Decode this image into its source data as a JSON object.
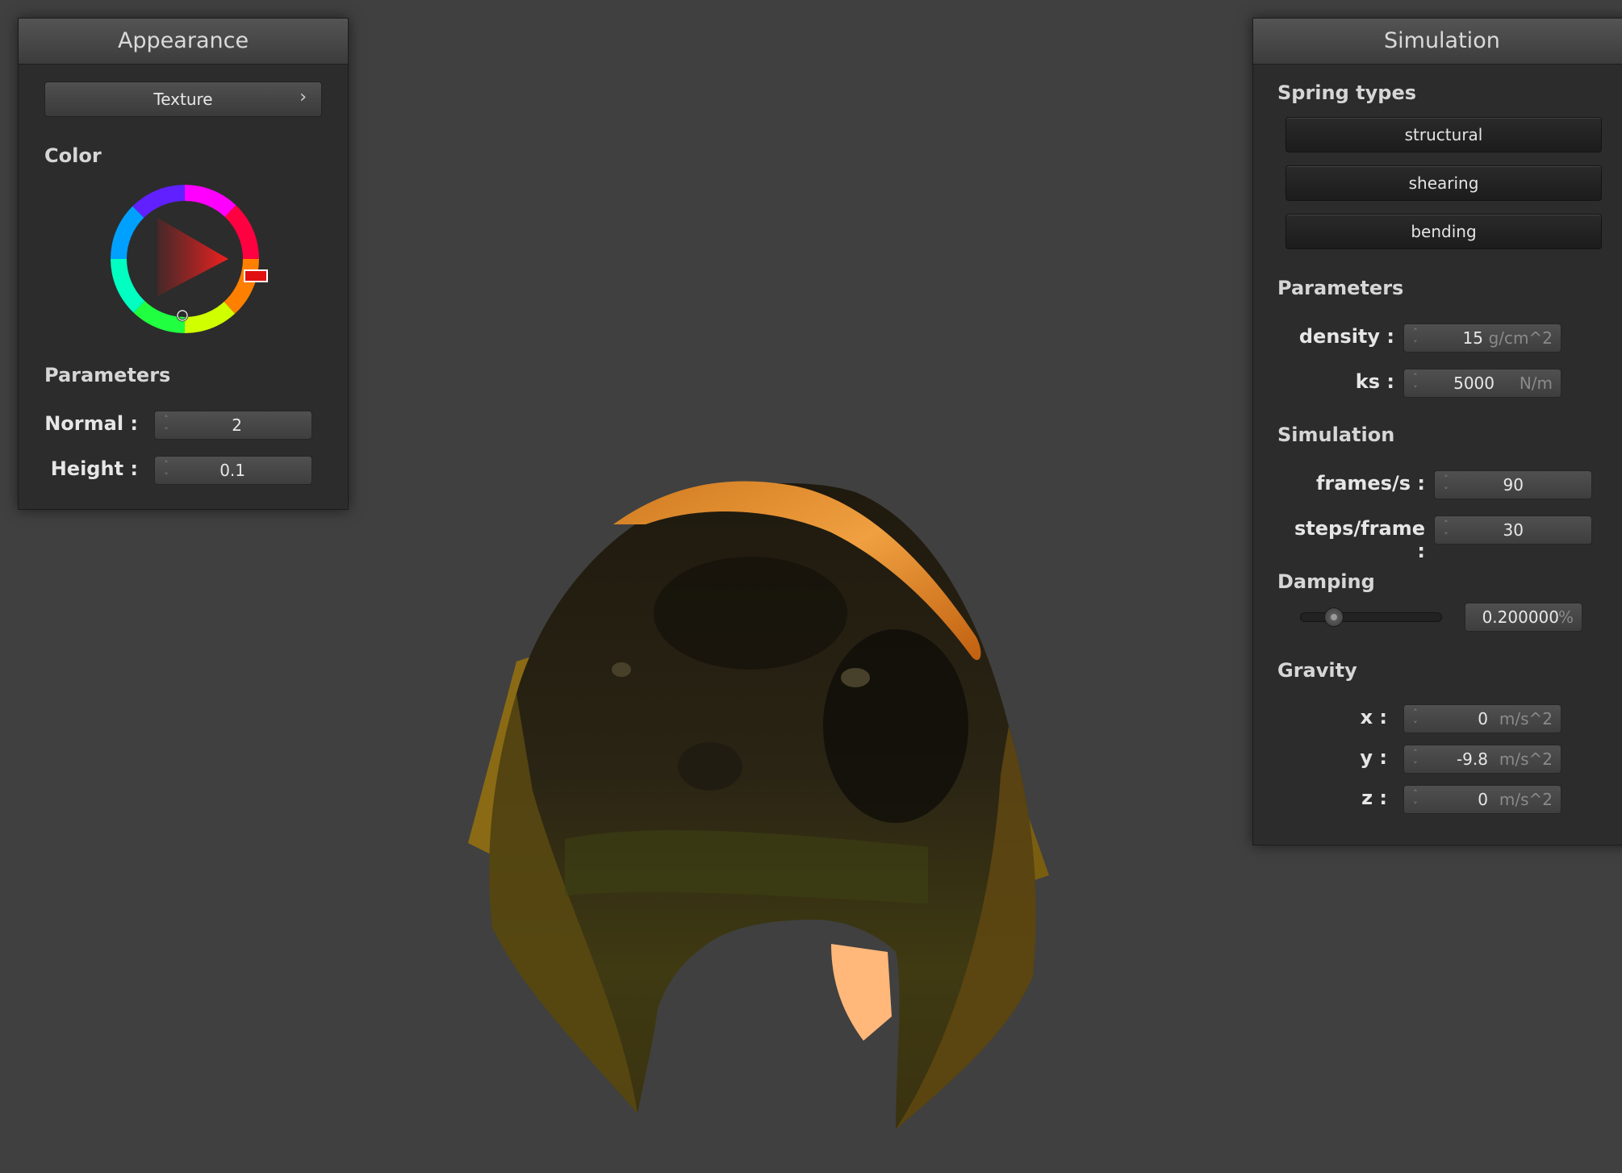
{
  "appearance": {
    "title": "Appearance",
    "texture_button": "Texture",
    "texture_chevron": "›",
    "color_label": "Color",
    "params_label": "Parameters",
    "normal_label": "Normal :",
    "normal_value": "2",
    "height_label": "Height :",
    "height_value": "0.1",
    "selected_hue": "#e01010"
  },
  "simulation": {
    "title": "Simulation",
    "spring_types_label": "Spring types",
    "spring_buttons": [
      "structural",
      "shearing",
      "bending"
    ],
    "params_label": "Parameters",
    "density_label": "density :",
    "density_value": "15",
    "density_unit": "g/cm^2",
    "ks_label": "ks :",
    "ks_value": "5000",
    "ks_unit": "N/m",
    "sim_label": "Simulation",
    "fps_label": "frames/s :",
    "fps_value": "90",
    "steps_label": "steps/frame :",
    "steps_value": "30",
    "damping_label": "Damping",
    "damping_value": "0.200000",
    "damping_unit": "%",
    "damping_level_percent": 0.2,
    "gravity_label": "Gravity",
    "gx_label": "x :",
    "gx_value": "0",
    "gy_label": "y :",
    "gy_value": "-9.8",
    "gz_label": "z :",
    "gz_value": "0",
    "gravity_unit": "m/s^2"
  },
  "icons": {
    "spin_up": "˄",
    "spin_down": "˅"
  }
}
